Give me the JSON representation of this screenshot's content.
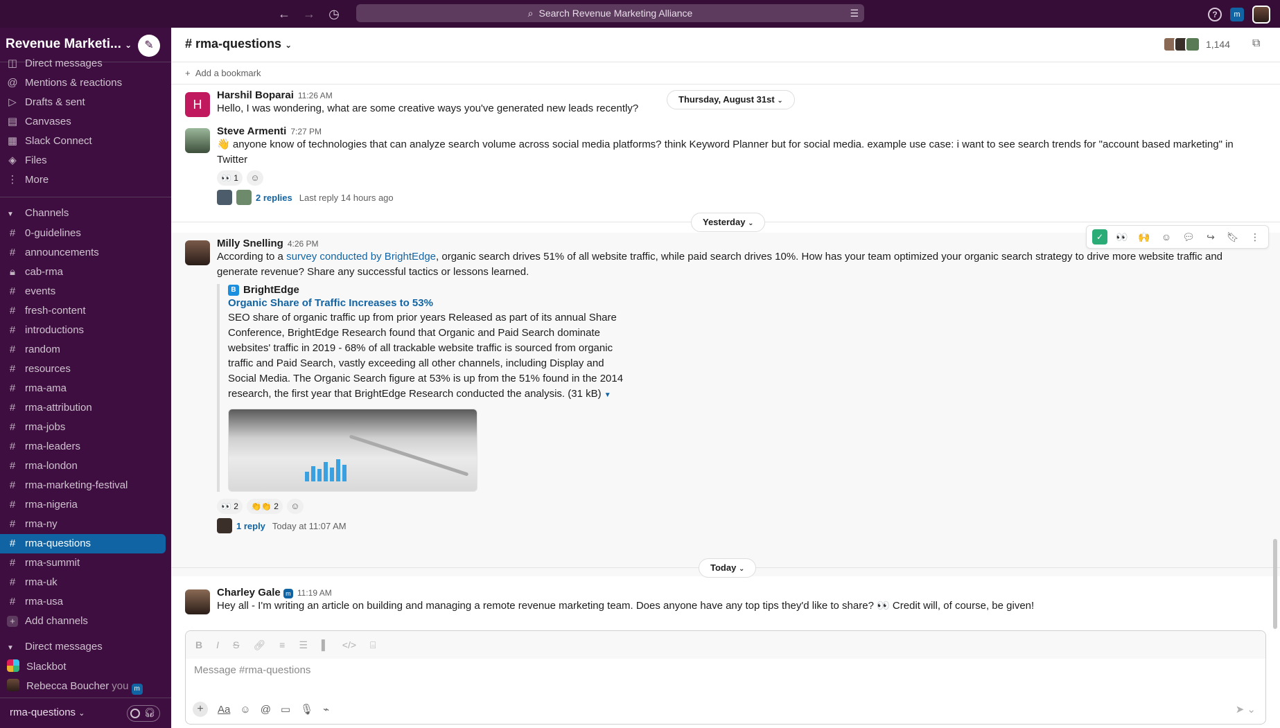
{
  "topbar": {
    "search_placeholder": "Search Revenue Marketing Alliance",
    "back_icon": "arrow-left-icon",
    "forward_icon": "arrow-right-icon",
    "history_icon": "clock-icon",
    "workspace_badge": "m"
  },
  "sidebar": {
    "workspace_name": "Revenue Marketi...",
    "nav_items": [
      {
        "label": "Direct messages",
        "icon": "chat-icon"
      },
      {
        "label": "Mentions & reactions",
        "icon": "at-icon"
      },
      {
        "label": "Drafts & sent",
        "icon": "send-icon"
      },
      {
        "label": "Canvases",
        "icon": "canvas-icon"
      },
      {
        "label": "Slack Connect",
        "icon": "building-icon"
      },
      {
        "label": "Files",
        "icon": "files-icon"
      },
      {
        "label": "More",
        "icon": "more-vertical-icon"
      }
    ],
    "channels_label": "Channels",
    "channels": [
      {
        "name": "0-guidelines"
      },
      {
        "name": "announcements"
      },
      {
        "name": "cab-rma",
        "locked": true
      },
      {
        "name": "events"
      },
      {
        "name": "fresh-content"
      },
      {
        "name": "introductions"
      },
      {
        "name": "random"
      },
      {
        "name": "resources"
      },
      {
        "name": "rma-ama"
      },
      {
        "name": "rma-attribution"
      },
      {
        "name": "rma-jobs"
      },
      {
        "name": "rma-leaders"
      },
      {
        "name": "rma-london"
      },
      {
        "name": "rma-marketing-festival"
      },
      {
        "name": "rma-nigeria"
      },
      {
        "name": "rma-ny"
      },
      {
        "name": "rma-questions",
        "active": true
      },
      {
        "name": "rma-summit"
      },
      {
        "name": "rma-uk"
      },
      {
        "name": "rma-usa"
      }
    ],
    "add_channels": "Add channels",
    "dm_label": "Direct messages",
    "dms": [
      {
        "name": "Slackbot"
      },
      {
        "name": "Rebecca Boucher",
        "suffix": "you",
        "badge": "m"
      }
    ],
    "footer_channel": "rma-questions"
  },
  "channel": {
    "title": "# rma-questions",
    "member_count": "1,144",
    "add_bookmark": "Add a bookmark"
  },
  "date_pills": {
    "first": "Thursday, August 31st",
    "second": "Yesterday",
    "third": "Today"
  },
  "messages": [
    {
      "sender": "Harshil Boparai",
      "time": "11:26 AM",
      "avatar_letter": "H",
      "avatar_color": "#c0195d",
      "text": "Hello, I was wondering, what are some creative ways you've generated new leads recently?"
    },
    {
      "sender": "Steve Armenti",
      "time": "7:27 PM",
      "text": "anyone know of technologies that can analyze search volume across social media platforms? think Keyword Planner but for social media. example use case: i want to see search trends for \"account based marketing\" in Twitter",
      "emoji_prefix": "👋",
      "reaction_count": "1",
      "replies": "2 replies",
      "last_reply": "Last reply 14 hours ago"
    },
    {
      "sender": "Milly Snelling",
      "time": "4:26 PM",
      "text_before": "According to a ",
      "link_text": "survey conducted by BrightEdge",
      "text_after": ", organic search drives 51% of all website traffic, while paid search drives 10%. How has your team optimized your organic search strategy to drive more website traffic and generate revenue? Share any successful tactics or lessons learned.",
      "unfurl_source": "BrightEdge",
      "unfurl_title": "Organic Share of Traffic Increases to 53%",
      "unfurl_desc": "SEO share of organic traffic up from prior years Released as part of its annual Share Conference, BrightEdge Research found that Organic and Paid Search dominate websites' traffic in 2019 - 68% of all trackable website traffic is sourced from organic traffic and Paid Search, vastly exceeding all other channels, including Display and Social Media. The Organic Search figure at 53% is up from the 51% found in the 2014 research, the first year that BrightEdge Research conducted the analysis. (31 kB)",
      "reaction1_count": "2",
      "reaction2_count": "2",
      "replies": "1 reply",
      "last_reply": "Today at 11:07 AM"
    },
    {
      "sender": "Charley Gale",
      "time": "11:19 AM",
      "text": "Hey all - I'm writing an article on building and managing a remote revenue marketing team. Does anyone have any top tips they'd like to share? 👀 Credit will, of course, be given!"
    }
  ],
  "composer": {
    "placeholder": "Message #rma-questions",
    "aa_label": "Aa"
  }
}
